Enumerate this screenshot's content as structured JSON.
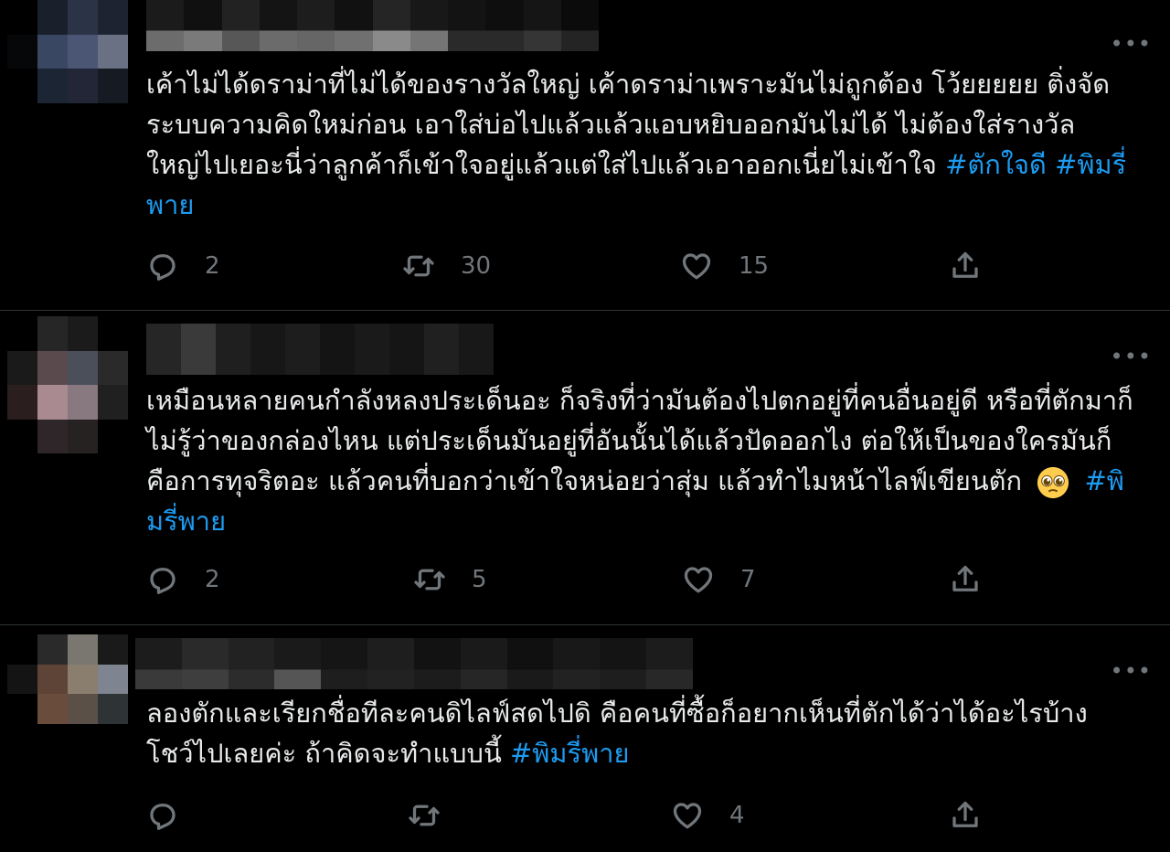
{
  "tweets": [
    {
      "text": "เค้าไม่ได้ดราม่าที่ไม่ได้ของรางวัลใหญ่ เค้าดราม่าเพราะมันไม่ถูกต้อง โว้ยยยยย ติ่งจัดระบบความคิดใหม่ก่อน เอาใส่บ่อไปแล้วแล้วแอบหยิบออกมันไม่ได้ ไม่ต้องใส่รางวัล ใหญ่ไปเยอะนี่ว่าลูกค้าก็เข้าใจอยู่แล้วแต่ใส่ไปแล้วเอาออกเนี่ยไม่เข้าใจ",
      "hashtags": [
        "#ตักใจดี",
        "#พิมรี่พาย"
      ],
      "replies": "2",
      "retweets": "30",
      "likes": "15"
    },
    {
      "text": "เหมือนหลายคนกำลังหลงประเด็นอะ ก็จริงที่ว่ามันต้องไปตกอยู่ที่คนอื่นอยู่ดี หรือที่ตักมาก็ไม่รู้ว่าของกล่องไหน แต่ประเด็นมันอยู่ที่อันนั้นได้แล้วปัดออกไง ต่อให้เป็นของใครมันก็คือการทุจริตอะ  แล้วคนที่บอกว่าเข้าใจหน่อยว่าสุ่ม แล้วทำไมหน้าไลฟ์เขียนตัก",
      "hashtags": [
        "#พิมรี่พาย"
      ],
      "emoji": "pleading-face-emoji",
      "replies": "2",
      "retweets": "5",
      "likes": "7"
    },
    {
      "text": "ลองตักและเรียกชื่อทีละคนดิไลฟ์สดไปดิ คือคนที่ซื้อก็อยากเห็นที่ตักได้ว่าได้อะไรบ้างโชว์ไปเลยค่ะ ถ้าคิดจะทำแบบนี้",
      "hashtags": [
        "#พิมรี่พาย"
      ],
      "replies": "",
      "retweets": "",
      "likes": "4"
    }
  ],
  "more_label": "•••",
  "icons": [
    "reply-icon",
    "retweet-icon",
    "like-icon",
    "share-icon",
    "more-icon"
  ],
  "colors": {
    "background": "#000000",
    "text": "#e7e9ea",
    "muted": "#71767b",
    "hashtag": "#1d9bf0",
    "divider": "#2f3336"
  }
}
